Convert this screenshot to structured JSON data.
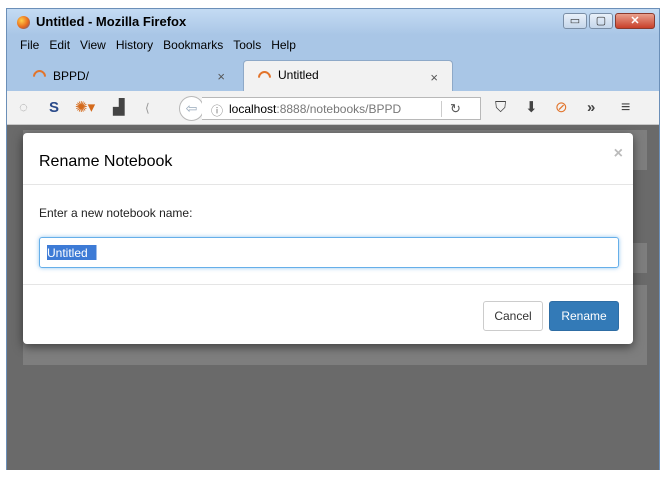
{
  "window": {
    "title": "Untitled - Mozilla Firefox",
    "controls": {
      "minimize": "▭",
      "maximize": "▢",
      "close": "✕"
    }
  },
  "menu": [
    "File",
    "Edit",
    "View",
    "History",
    "Bookmarks",
    "Tools",
    "Help"
  ],
  "tabs": [
    {
      "label": "BPPD/",
      "active": false,
      "close": "×"
    },
    {
      "label": "Untitled",
      "active": true,
      "close": "×"
    }
  ],
  "toolbar": {
    "icons": [
      "rss-icon",
      "s-addon-icon",
      "fox-addon-icon",
      "incognito-icon",
      "back-arrow-icon"
    ],
    "url": {
      "host": "localhost",
      "path": ":8888/notebooks/BPPD"
    },
    "right_icons": [
      "pocket-icon",
      "download-icon",
      "blocker-icon",
      "overflow-icon",
      "menu-icon"
    ]
  },
  "dialog": {
    "title": "Rename Notebook",
    "close": "×",
    "prompt": "Enter a new notebook name:",
    "input_value": "Untitled",
    "cancel_label": "Cancel",
    "rename_label": "Rename"
  },
  "colors": {
    "primary": "#337ab7",
    "overlay": "#6a6a6a",
    "focus": "#66afe9"
  }
}
